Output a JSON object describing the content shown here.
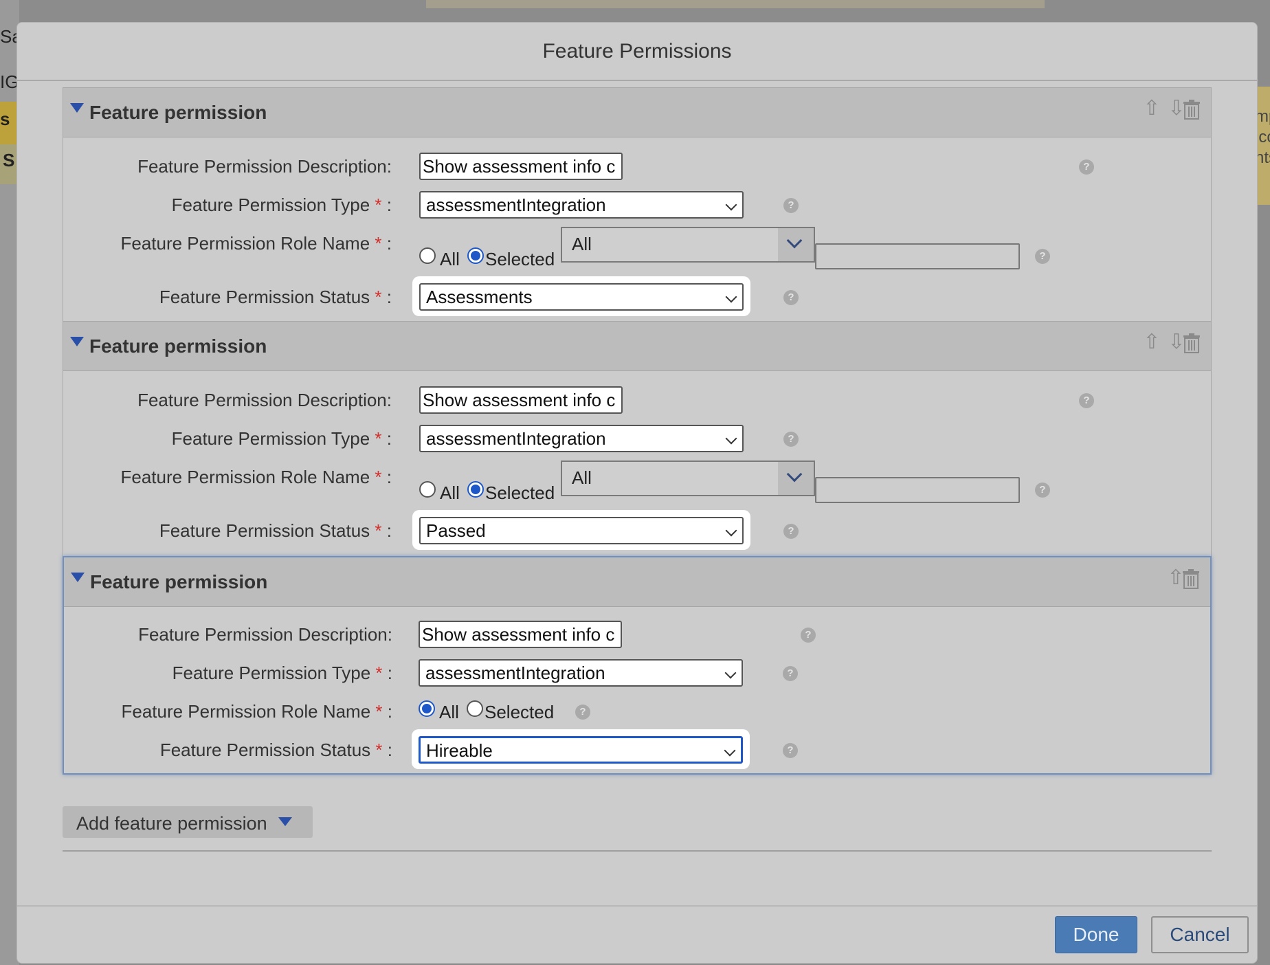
{
  "background": {
    "left_fragments": [
      "Sa",
      "IG",
      "s",
      "S"
    ],
    "right_fragments": [
      "mp",
      "ico",
      "nts"
    ]
  },
  "dialog": {
    "title": "Feature Permissions",
    "add_button_label": "Add feature permission",
    "done_label": "Done",
    "cancel_label": "Cancel"
  },
  "labels": {
    "description": "Feature Permission Description:",
    "type": "Feature Permission Type",
    "role_name": "Feature Permission Role Name",
    "status": "Feature Permission Status",
    "required_mark": "*",
    "colon": " :",
    "radio_all": "All",
    "radio_selected": "Selected",
    "help_glyph": "?"
  },
  "panels": [
    {
      "title": "Feature permission",
      "description_value": "Show assessment info c",
      "type_value": "assessmentIntegration",
      "role_mode": "Selected",
      "role_select_value": "All",
      "role_input_value": "",
      "status_value": "Assessments",
      "controls": [
        "move-up",
        "move-down",
        "delete"
      ]
    },
    {
      "title": "Feature permission",
      "description_value": "Show assessment info c",
      "type_value": "assessmentIntegration",
      "role_mode": "Selected",
      "role_select_value": "All",
      "role_input_value": "",
      "status_value": "Passed",
      "controls": [
        "move-up",
        "move-down",
        "delete"
      ]
    },
    {
      "title": "Feature permission",
      "description_value": "Show assessment info c",
      "type_value": "assessmentIntegration",
      "role_mode": "All",
      "status_value": "Hireable",
      "controls": [
        "move-up",
        "delete"
      ],
      "focused": true
    }
  ],
  "icons": {
    "up": "⇧",
    "down": "⇩"
  },
  "colors": {
    "accent_blue": "#1d57c8",
    "done_button": "#4a7bb4",
    "required_red": "#d0312d",
    "dialog_bg": "#cccccc"
  }
}
